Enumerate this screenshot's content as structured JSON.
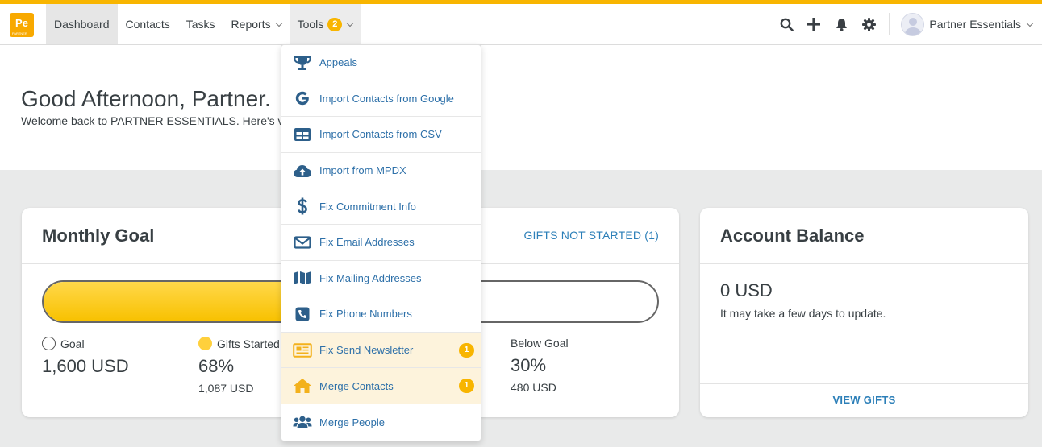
{
  "brand": {
    "logo_text": "Pe",
    "logo_sub": "PARTNER"
  },
  "nav": {
    "dashboard": "Dashboard",
    "contacts": "Contacts",
    "tasks": "Tasks",
    "reports": "Reports",
    "tools": "Tools",
    "tools_badge": "2"
  },
  "header": {
    "user_name": "Partner Essentials"
  },
  "welcome": {
    "greeting": "Good Afternoon, Partner.",
    "subline": "Welcome back to PARTNER ESSENTIALS. Here's v"
  },
  "monthly_goal": {
    "title": "Monthly Goal",
    "link": "GIFTS NOT STARTED (1)",
    "progress": 0.68,
    "goal_label": "Goal",
    "goal_value": "1,600 USD",
    "started_label": "Gifts Started",
    "started_pct": "68%",
    "started_amount": "1,087 USD",
    "below_label": "Below Goal",
    "below_pct": "30%",
    "below_amount": "480 USD"
  },
  "account_balance": {
    "title": "Account Balance",
    "value": "0 USD",
    "note": "It may take a few days to update.",
    "link": "VIEW GIFTS"
  },
  "tools_menu": {
    "items": [
      {
        "label": "Appeals",
        "icon": "trophy-icon"
      },
      {
        "label": "Import Contacts from Google",
        "icon": "google-icon"
      },
      {
        "label": "Import Contacts from CSV",
        "icon": "table-icon"
      },
      {
        "label": "Import from MPDX",
        "icon": "cloud-upload-icon"
      },
      {
        "label": "Fix Commitment Info",
        "icon": "dollar-icon"
      },
      {
        "label": "Fix Email Addresses",
        "icon": "envelope-icon"
      },
      {
        "label": "Fix Mailing Addresses",
        "icon": "map-icon"
      },
      {
        "label": "Fix Phone Numbers",
        "icon": "phone-icon"
      },
      {
        "label": "Fix Send Newsletter",
        "icon": "newspaper-icon",
        "badge": "1"
      },
      {
        "label": "Merge Contacts",
        "icon": "home-icon",
        "badge": "1"
      },
      {
        "label": "Merge People",
        "icon": "users-icon"
      }
    ]
  },
  "colors": {
    "accent": "#f8b500",
    "link": "#2c7fb8",
    "menu_icon": "#2d5f8a",
    "highlight": "#fdf3dc"
  }
}
